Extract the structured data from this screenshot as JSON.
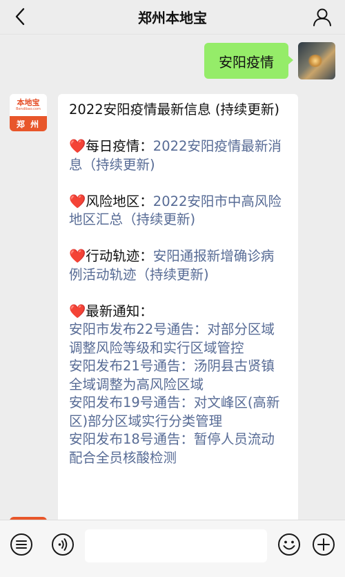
{
  "header": {
    "title": "郑州本地宝",
    "back_icon": "chevron-left-icon",
    "profile_icon": "person-icon"
  },
  "messages": {
    "outgoing": {
      "text": "安阳疫情"
    },
    "bot": {
      "avatar": {
        "brand": "本地宝",
        "site": "Bendibao.com",
        "city": "郑 州"
      },
      "intro": "2022安阳疫情最新信息 (持续更新)",
      "sections": [
        {
          "heart": "❤️",
          "label": "每日疫情：",
          "link": "2022安阳疫情最新消息（持续更新)"
        },
        {
          "heart": "❤️",
          "label": "风险地区：",
          "link": "2022安阳市中高风险地区汇总（持续更新)"
        },
        {
          "heart": "❤️",
          "label": "行动轨迹：",
          "link": "安阳通报新增确诊病例活动轨迹（持续更新)"
        }
      ],
      "notices_heading": {
        "heart": "❤️",
        "label": "最新通知："
      },
      "notices": [
        "安阳市发布22号通告：对部分区域调整风险等级和实行区域管控",
        "安阳发布21号通告：汤阴县古贤镇全域调整为高风险区域",
        "安阳发布19号通告：对文峰区(高新区)部分区域实行分类管理",
        "安阳发布18号通告：暂停人员流动配合全员核酸检测"
      ]
    }
  },
  "toolbar": {
    "menu_icon": "menu-list-icon",
    "voice_icon": "voice-icon",
    "input_value": "",
    "emoji_icon": "smiley-icon",
    "plus_icon": "plus-icon"
  },
  "colors": {
    "background": "#ededed",
    "outgoing_bubble": "#95ec69",
    "link": "#576b95",
    "brand": "#e8562a"
  }
}
